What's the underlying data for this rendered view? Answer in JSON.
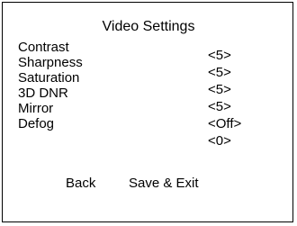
{
  "menu": {
    "title": "Video Settings",
    "items": [
      {
        "label": "Contrast",
        "value": "<5>"
      },
      {
        "label": "Sharpness",
        "value": "<5>"
      },
      {
        "label": "Saturation",
        "value": "<5>"
      },
      {
        "label": "3D DNR",
        "value": "<5>"
      },
      {
        "label": "Mirror",
        "value": "<Off>"
      },
      {
        "label": "Defog",
        "value": "<0>"
      }
    ],
    "back_label": "Back",
    "save_exit_label": "Save & Exit"
  },
  "colors": {
    "background": "#ffffff",
    "text": "#000000",
    "border": "#000000"
  }
}
